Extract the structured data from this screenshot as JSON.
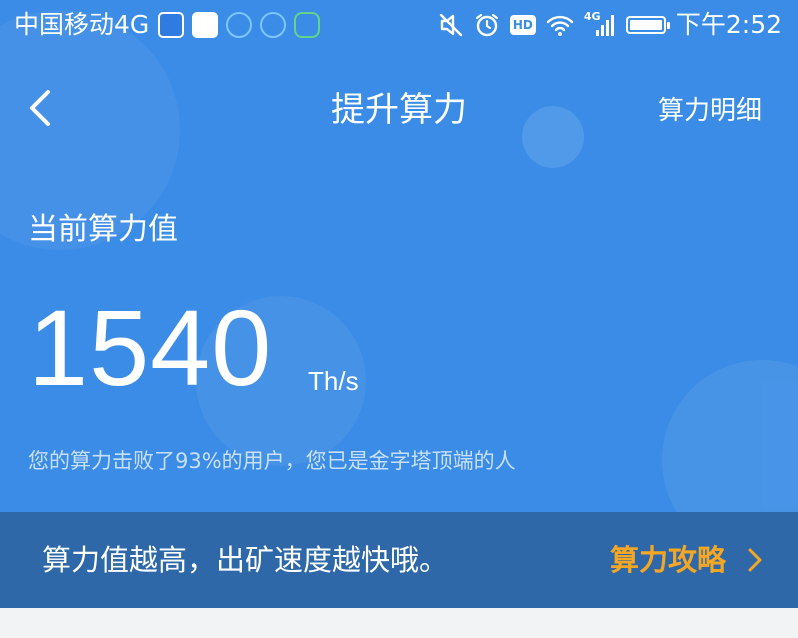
{
  "status_bar": {
    "carrier": "中国移动4G",
    "time": "下午2:52",
    "hd": "HD",
    "net": "4G",
    "app_icons": [
      "qq-app-icon",
      "telegram-app-icon",
      "browser-app-icon",
      "phone-app-icon",
      "wechat-app-icon"
    ]
  },
  "nav": {
    "title": "提升算力",
    "right_label": "算力明细"
  },
  "summary": {
    "label": "当前算力值",
    "value": "1540",
    "unit": "Th/s",
    "description": "您的算力击败了93%的用户，您已是金字塔顶端的人"
  },
  "tip": {
    "text": "算力值越高，出矿速度越快哦。",
    "link_label": "算力攻略"
  },
  "colors": {
    "header_bg": "#3a8ce6",
    "tip_bg": "#2e68a8",
    "accent": "#f5a623"
  }
}
